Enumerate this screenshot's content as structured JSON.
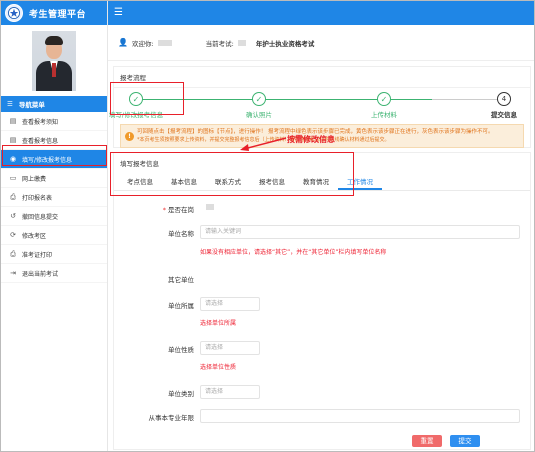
{
  "app": {
    "title": "考生管理平台"
  },
  "sidebar": {
    "menu_title": "导航菜单",
    "items": [
      {
        "label": "查看报考须知",
        "icon": "document-icon"
      },
      {
        "label": "查看报考信息",
        "icon": "document-icon"
      },
      {
        "label": "填写/修改报考信息",
        "icon": "location-pin-icon",
        "active": true
      },
      {
        "label": "网上缴费",
        "icon": "payment-icon"
      },
      {
        "label": "打印报名表",
        "icon": "printer-icon"
      },
      {
        "label": "撤回信息提交",
        "icon": "undo-icon"
      },
      {
        "label": "修改考区",
        "icon": "refresh-icon"
      },
      {
        "label": "准考证打印",
        "icon": "printer-icon"
      },
      {
        "label": "退出当前考试",
        "icon": "exit-icon"
      }
    ]
  },
  "header": {
    "welcome_label": "欢迎你:",
    "current_exam_label": "当前考试:",
    "current_exam": "年护士执业资格考试"
  },
  "process": {
    "title": "报考流程",
    "steps": [
      {
        "label": "填写/修改报考信息",
        "done": true
      },
      {
        "label": "确认照片",
        "done": true
      },
      {
        "label": "上传材料",
        "done": true
      },
      {
        "label": "提交信息",
        "number": "4"
      }
    ],
    "notice_line1": "可回随点击【报考流程】的图标【节点】，进行操作！ 报考流程中绿色表示该步骤已完成，黄色表示该步骤正在进行，灰色表示该步骤为操作不可。",
    "notice_line2": "*本页考生须按照要求上传资料，并提交完整报考信息后（上传资料）请在待报考试机构在线确认材料通过后提交。"
  },
  "form": {
    "title": "填写报考信息",
    "tabs": [
      "考点信息",
      "基本信息",
      "联系方式",
      "报考信息",
      "教育情况",
      "工作情况"
    ],
    "active_tab": "工作情况",
    "fields": {
      "on_duty_label": "是否在岗",
      "unit_name_label": "单位名称",
      "unit_name_placeholder": "请输入关键词",
      "unit_name_hint": "如果没有相应单位，请选择“其它”，并在“其它单位”栏内填写单位名称",
      "other_unit_label": "其它单位",
      "unit_belong_label": "单位所属",
      "unit_belong_placeholder": "请选择",
      "unit_belong_hint": "选择单位所属",
      "unit_nature_label": "单位性质",
      "unit_nature_placeholder": "请选择",
      "unit_nature_hint": "选择单位性质",
      "unit_type_label": "单位类别",
      "unit_type_placeholder": "请选择",
      "years_label": "从事本专业年限"
    },
    "reset_label": "重置",
    "submit_label": "提交"
  },
  "annotation": {
    "text": "按需修改信息",
    "color": "#e8202a"
  },
  "colors": {
    "primary": "#1f86e6",
    "success": "#3cb371",
    "warning": "#e0731a",
    "danger": "#e23"
  }
}
